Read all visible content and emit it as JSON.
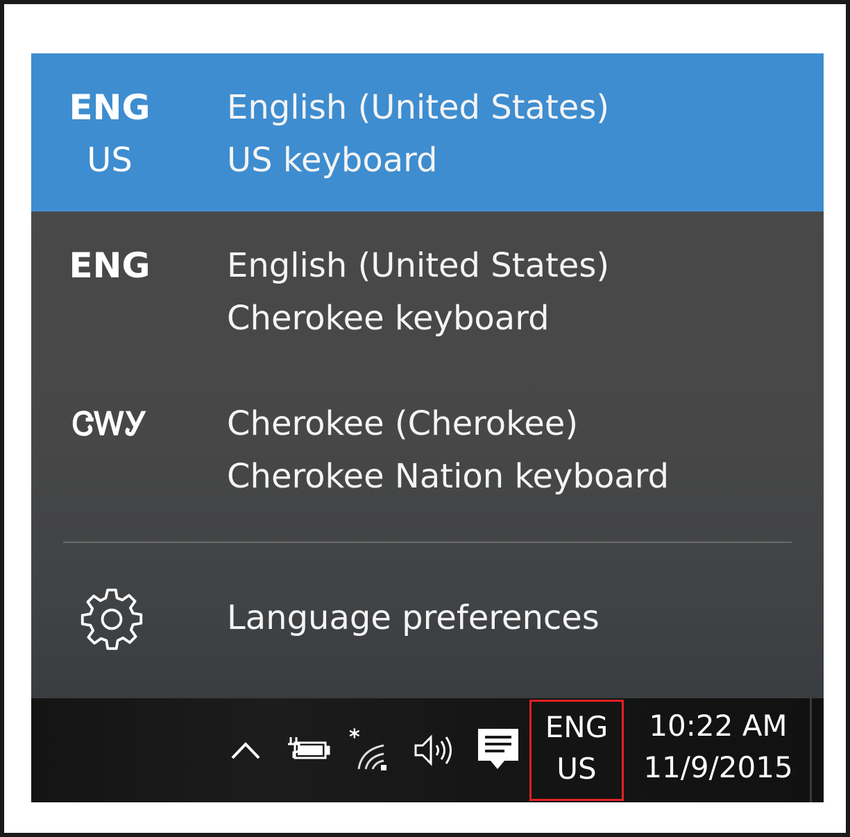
{
  "flyout": {
    "items": [
      {
        "abbr_top": "ENG",
        "abbr_bottom": "US",
        "language": "English (United States)",
        "keyboard": "US keyboard",
        "selected": true
      },
      {
        "abbr_top": "ENG",
        "abbr_bottom": "",
        "language": "English (United States)",
        "keyboard": "Cherokee keyboard",
        "selected": false
      },
      {
        "abbr_top": "ᏣᎳᎩ",
        "abbr_bottom": "",
        "language": "Cherokee (Cherokee)",
        "keyboard": "Cherokee Nation keyboard",
        "selected": false
      }
    ],
    "preferences_label": "Language preferences",
    "preferences_icon": "gear-icon"
  },
  "taskbar": {
    "input_indicator": {
      "top": "ENG",
      "bottom": "US"
    },
    "clock": {
      "time": "10:22 AM",
      "date": "11/9/2015"
    },
    "icons": [
      "chevron-up-icon",
      "battery-charging-icon",
      "wifi-icon",
      "volume-icon",
      "action-center-icon"
    ]
  },
  "colors": {
    "selected_bg": "#3e8dd0",
    "flyout_bg": "#474747",
    "highlight_border": "#e32222"
  }
}
